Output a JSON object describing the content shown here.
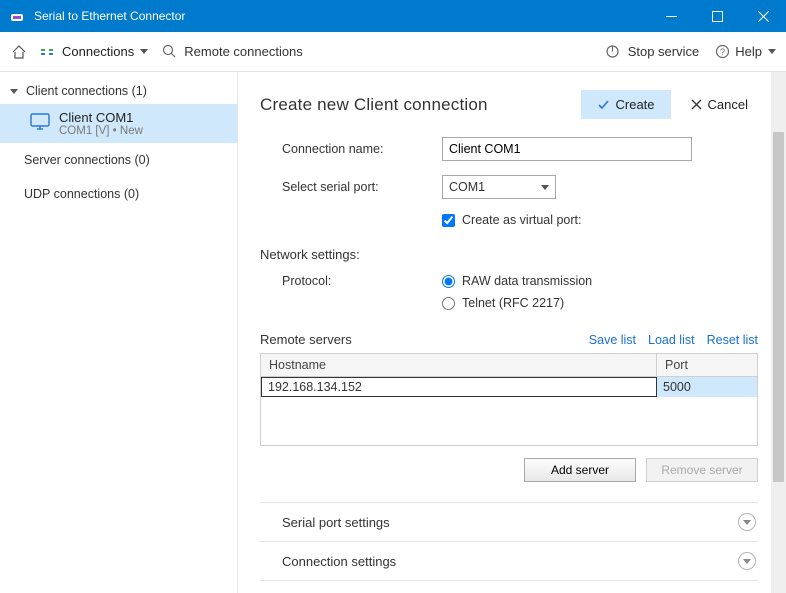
{
  "window": {
    "title": "Serial to Ethernet Connector"
  },
  "toolbar": {
    "connections": "Connections",
    "remote": "Remote connections",
    "stop": "Stop service",
    "help": "Help"
  },
  "sidebar": {
    "client_hdr": "Client connections (1)",
    "item": {
      "name": "Client COM1",
      "sub": "COM1 [V] • New"
    },
    "server_hdr": "Server connections (0)",
    "udp_hdr": "UDP connections (0)"
  },
  "main": {
    "title": "Create new Client connection",
    "create": "Create",
    "cancel": "Cancel",
    "name_label": "Connection name:",
    "name_value": "Client COM1",
    "port_label": "Select serial port:",
    "port_value": "COM1",
    "virtual_label": "Create as virtual port:",
    "net_section": "Network settings:",
    "protocol_label": "Protocol:",
    "raw_label": "RAW data transmission",
    "telnet_label": "Telnet (RFC 2217)",
    "remote_section": "Remote servers",
    "savelist": "Save list",
    "loadlist": "Load list",
    "resetlist": "Reset list",
    "col_host": "Hostname",
    "col_port": "Port",
    "row_host": "192.168.134.152",
    "row_port": "5000",
    "add_server": "Add server",
    "remove_server": "Remove server",
    "acc1": "Serial port settings",
    "acc2": "Connection settings"
  }
}
